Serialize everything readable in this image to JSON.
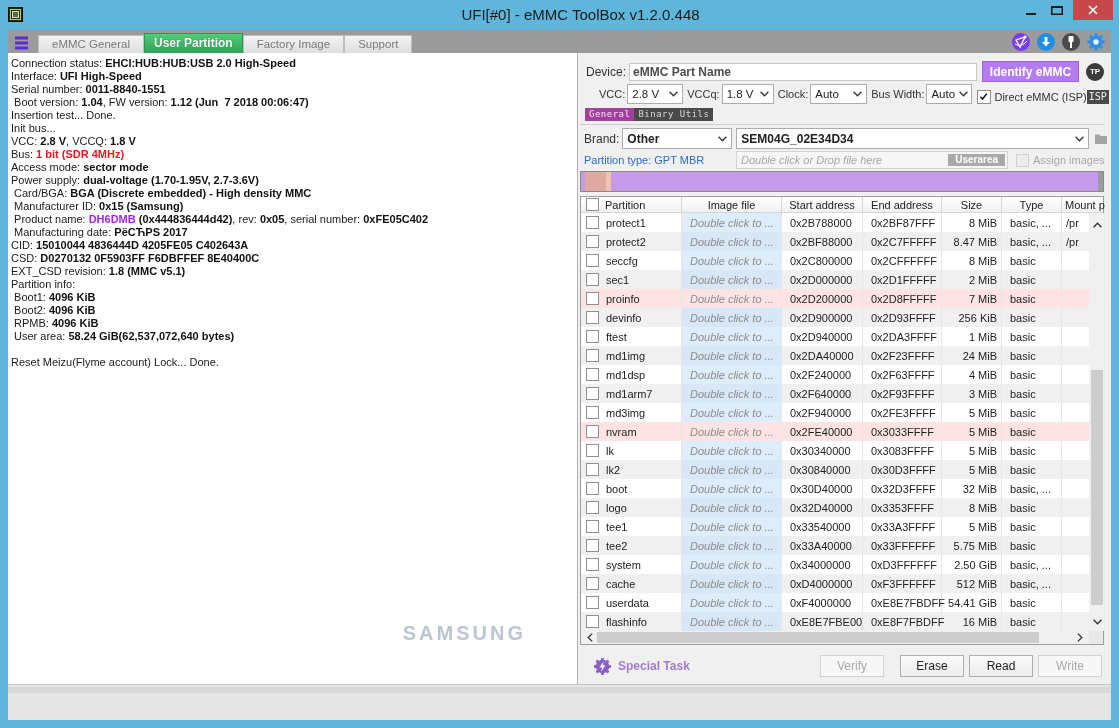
{
  "window": {
    "title": "UFI[#0] - eMMC ToolBox v1.2.0.448"
  },
  "tabs": [
    {
      "label": "eMMC General",
      "selected": false
    },
    {
      "label": "User Partition",
      "selected": true
    },
    {
      "label": "Factory Image",
      "selected": false
    },
    {
      "label": "Support",
      "selected": false
    }
  ],
  "log": {
    "blocks": [
      {
        "lines": [
          {
            "text": "Connection status: **EHCI:HUB:HUB:USB 2.0 High-Speed**"
          },
          {
            "text": "Interface: **UFI High-Speed**"
          },
          {
            "text": "Serial number: **0011-8840-1551**"
          },
          {
            "text": " Boot version: **1.04**, FW version: **1.12 (Jun  7 2018 00:06:47)**"
          },
          {
            "text": "Insertion test... Done."
          },
          {
            "text": "Init bus..."
          },
          {
            "text": "VCC: **2.8 V**, VCCQ: **1.8 V**"
          },
          {
            "text": "Bus: **1 bit (SDR 4MHz)**",
            "color": "#e8191d"
          },
          {
            "text": "Access mode: **sector mode**"
          },
          {
            "text": "Power supply: **dual-voltage (1.70-1.95V, 2.7-3.6V)**"
          },
          {
            "text": " Card/BGA: **BGA (Discrete embedded) - High density MMC**"
          },
          {
            "text": " Manufacturer ID: **0x15 (Samsung)**"
          },
          {
            "text": " Product name: **DH6DMB** **(0x444836444d42)**, rev: **0x05**, serial number: **0xFE05C402**",
            "color": "#a326e8"
          },
          {
            "text": " Manufacturing date: **РёСЋРЅ 2017**"
          },
          {
            "text": "CID: **15010044 4836444D 4205FE05 C402643A**"
          },
          {
            "text": "CSD: **D0270132 0F5903FF F6DBFFEF 8E40400C**"
          },
          {
            "text": "EXT_CSD revision: **1.8 (MMC v5.1)**"
          },
          {
            "text": "Partition info:"
          },
          {
            "text": " Boot1: **4096 KiB**"
          },
          {
            "text": " Boot2: **4096 KiB**"
          },
          {
            "text": " RPMB: **4096 KiB**"
          },
          {
            "text": " User area: **58.24 GiB(62,537,072,640 bytes)**"
          }
        ]
      },
      {
        "lines": [
          {
            "text": "Reset Meizu(Flyme account) Lock... Done."
          }
        ]
      }
    ],
    "brand_logo": "SAMSUNG"
  },
  "device": {
    "label": "Device:",
    "value": "eMMC Part Name",
    "identify_button": "Identify eMMC",
    "tp_badge": "TP"
  },
  "settings": {
    "fields": [
      {
        "label": "VCC:",
        "value": "2.8 V"
      },
      {
        "label": "VCCq:",
        "value": "1.8 V"
      },
      {
        "label": "Clock:",
        "value": "Auto"
      },
      {
        "label": "Bus Width:",
        "value": "Auto"
      }
    ],
    "direct_emmc": {
      "label": "Direct eMMC (ISP)",
      "checked": true
    },
    "isp_badge": "ISP"
  },
  "subtabs": [
    {
      "label": "General",
      "selected": true
    },
    {
      "label": "Binary Utils",
      "selected": false
    }
  ],
  "brand": {
    "label": "Brand:",
    "value": "Other",
    "model": "SEM04G_02E34D34"
  },
  "partition_type": "Partition type: GPT MBR",
  "image_field": {
    "placeholder": "Double click or Drop file here",
    "tag": "Userarea"
  },
  "assign_images": {
    "label": "Assign images",
    "checked": false,
    "disabled": true
  },
  "table": {
    "select_all": {
      "checked": false
    },
    "columns": [
      "Partition",
      "Image file",
      "Start address",
      "End address",
      "Size",
      "Type",
      "Mount p"
    ],
    "rows": [
      {
        "checked": false,
        "highlighted": false,
        "cells": [
          "protect1",
          "Double click to ...",
          "0x2B788000",
          "0x2BF87FFF",
          "8 MiB",
          "basic, ...",
          "/pr"
        ]
      },
      {
        "checked": false,
        "highlighted": false,
        "cells": [
          "protect2",
          "Double click to ...",
          "0x2BF88000",
          "0x2C7FFFFF",
          "8.47 MiB",
          "basic, ...",
          "/pr"
        ]
      },
      {
        "checked": false,
        "highlighted": false,
        "cells": [
          "seccfg",
          "Double click to ...",
          "0x2C800000",
          "0x2CFFFFFF",
          "8 MiB",
          "basic"
        ]
      },
      {
        "checked": false,
        "highlighted": false,
        "cells": [
          "sec1",
          "Double click to ...",
          "0x2D000000",
          "0x2D1FFFFF",
          "2 MiB",
          "basic"
        ]
      },
      {
        "checked": false,
        "highlighted": true,
        "cells": [
          "proinfo",
          "Double click to ...",
          "0x2D200000",
          "0x2D8FFFFF",
          "7 MiB",
          "basic"
        ]
      },
      {
        "checked": false,
        "highlighted": false,
        "cells": [
          "devinfo",
          "Double click to ...",
          "0x2D900000",
          "0x2D93FFFF",
          "256 KiB",
          "basic"
        ]
      },
      {
        "checked": false,
        "highlighted": false,
        "cells": [
          "ftest",
          "Double click to ...",
          "0x2D940000",
          "0x2DA3FFFF",
          "1 MiB",
          "basic"
        ]
      },
      {
        "checked": false,
        "highlighted": false,
        "cells": [
          "md1img",
          "Double click to ...",
          "0x2DA40000",
          "0x2F23FFFF",
          "24 MiB",
          "basic"
        ]
      },
      {
        "checked": false,
        "highlighted": false,
        "cells": [
          "md1dsp",
          "Double click to ...",
          "0x2F240000",
          "0x2F63FFFF",
          "4 MiB",
          "basic"
        ]
      },
      {
        "checked": false,
        "highlighted": false,
        "cells": [
          "md1arm7",
          "Double click to ...",
          "0x2F640000",
          "0x2F93FFFF",
          "3 MiB",
          "basic"
        ]
      },
      {
        "checked": false,
        "highlighted": false,
        "cells": [
          "md3img",
          "Double click to ...",
          "0x2F940000",
          "0x2FE3FFFF",
          "5 MiB",
          "basic"
        ]
      },
      {
        "checked": false,
        "highlighted": true,
        "cells": [
          "nvram",
          "Double click to ...",
          "0x2FE40000",
          "0x3033FFFF",
          "5 MiB",
          "basic"
        ]
      },
      {
        "checked": false,
        "highlighted": false,
        "cells": [
          "lk",
          "Double click to ...",
          "0x30340000",
          "0x3083FFFF",
          "5 MiB",
          "basic"
        ]
      },
      {
        "checked": false,
        "highlighted": false,
        "cells": [
          "lk2",
          "Double click to ...",
          "0x30840000",
          "0x30D3FFFF",
          "5 MiB",
          "basic"
        ]
      },
      {
        "checked": false,
        "highlighted": false,
        "cells": [
          "boot",
          "Double click to ...",
          "0x30D40000",
          "0x32D3FFFF",
          "32 MiB",
          "basic, ..."
        ]
      },
      {
        "checked": false,
        "highlighted": false,
        "cells": [
          "logo",
          "Double click to ...",
          "0x32D40000",
          "0x3353FFFF",
          "8 MiB",
          "basic"
        ]
      },
      {
        "checked": false,
        "highlighted": false,
        "cells": [
          "tee1",
          "Double click to ...",
          "0x33540000",
          "0x33A3FFFF",
          "5 MiB",
          "basic"
        ]
      },
      {
        "checked": false,
        "highlighted": false,
        "cells": [
          "tee2",
          "Double click to ...",
          "0x33A40000",
          "0x33FFFFFF",
          "5.75 MiB",
          "basic"
        ]
      },
      {
        "checked": false,
        "highlighted": false,
        "cells": [
          "system",
          "Double click to ...",
          "0x34000000",
          "0xD3FFFFFF",
          "2.50 GiB",
          "basic, ..."
        ]
      },
      {
        "checked": false,
        "highlighted": false,
        "cells": [
          "cache",
          "Double click to ...",
          "0xD4000000",
          "0xF3FFFFFF",
          "512 MiB",
          "basic, ..."
        ]
      },
      {
        "checked": false,
        "highlighted": false,
        "cells": [
          "userdata",
          "Double click to ...",
          "0xF4000000",
          "0xE8E7FBDFF",
          "54.41 GiB",
          "basic"
        ]
      },
      {
        "checked": false,
        "highlighted": false,
        "cells": [
          "flashinfo",
          "Double click to ...",
          "0xE8E7FBE00",
          "0xE8F7FBDFF",
          "16 MiB",
          "basic"
        ]
      }
    ]
  },
  "special_task": "Special Task",
  "buttons": [
    {
      "label": "Verify",
      "disabled": true
    },
    {
      "label": "Erase",
      "disabled": false
    },
    {
      "label": "Read",
      "disabled": false
    },
    {
      "label": "Write",
      "disabled": true
    }
  ],
  "progress": {
    "level": 0
  }
}
